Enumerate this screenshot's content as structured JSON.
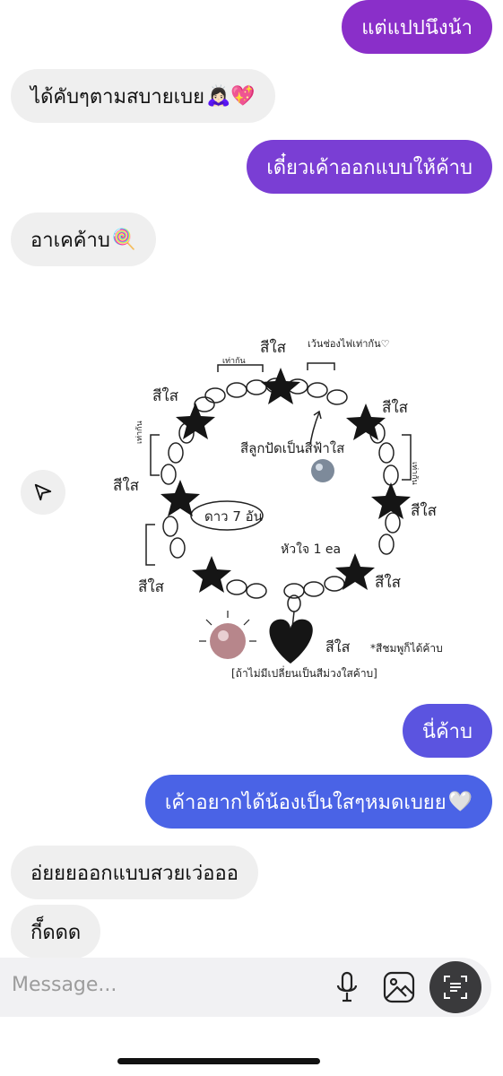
{
  "messages": [
    {
      "text": "แต่แปปนึงน้า",
      "side": "out"
    },
    {
      "text": "ได้คับๆตามสบายเบย",
      "emoji": "🙇🏻‍♀️💖",
      "side": "in"
    },
    {
      "text": "เดี๋ยวเค้าออกแบบให้ค้าบ",
      "side": "out"
    },
    {
      "text": "อาเคค้าบ",
      "emoji": "🍭",
      "side": "in"
    },
    {
      "text": "นี่ค้าบ",
      "side": "out"
    },
    {
      "text": "เค้าอยากได้น้องเป็นใสๆหมดเบยย",
      "emoji": "🤍",
      "side": "out"
    },
    {
      "text": "อ่ยยยออกแบบสวยเว่อออ",
      "side": "in"
    },
    {
      "text": "กี็ดดด",
      "side": "in"
    }
  ],
  "sketch": {
    "label_clear": "สีใส",
    "label_top_gap": "เว้นช่องไฟเท่ากัน♡",
    "label_center": "สีลูกปัดเป็นสีฟ้าใส",
    "label_stars": "ดาว 7 อัน",
    "label_hearts": "หัวใจ 1 ea",
    "label_note": "*สีชมพูก็ได้ค้าบ",
    "label_bottom": "[ถ้าไม่มีเปลี่ยนเป็นสีม่วงใสค้าบ]",
    "label_side": "เท่ากัน"
  },
  "composer": {
    "placeholder": "Message...",
    "icons": [
      "microphone-icon",
      "gallery-icon",
      "scan-icon"
    ]
  },
  "colors": {
    "purple": "#8a2fc9",
    "violet": "#7a3ed4",
    "blue_violet": "#5b54e0",
    "blue": "#4a63e6",
    "incoming": "#efefef"
  }
}
